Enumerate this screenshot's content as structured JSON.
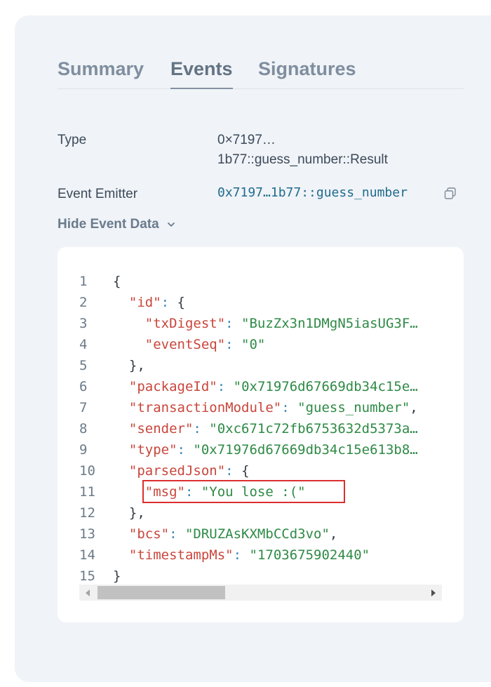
{
  "tabs": [
    {
      "label": "Summary",
      "active": false
    },
    {
      "label": "Events",
      "active": true
    },
    {
      "label": "Signatures",
      "active": false
    }
  ],
  "event": {
    "type_label": "Type",
    "type_value_line1": "0×7197…",
    "type_value_line2": "1b77::guess_number::Result",
    "emitter_label": "Event Emitter",
    "emitter_value": "0x7197…1b77::guess_number",
    "emitter_icon": "copy-icon"
  },
  "toggle": {
    "label": "Hide Event Data",
    "icon": "chevron-down-icon"
  },
  "code_lines": [
    {
      "n": "1",
      "tokens": [
        {
          "t": "{",
          "c": "x"
        }
      ]
    },
    {
      "n": "2",
      "tokens": [
        {
          "t": "  ",
          "c": "x"
        },
        {
          "t": "\"id\"",
          "c": "k"
        },
        {
          "t": ": ",
          "c": "p"
        },
        {
          "t": "{",
          "c": "x"
        }
      ]
    },
    {
      "n": "3",
      "tokens": [
        {
          "t": "    ",
          "c": "x"
        },
        {
          "t": "\"txDigest\"",
          "c": "k"
        },
        {
          "t": ": ",
          "c": "p"
        },
        {
          "t": "\"BuzZx3n1DMgN5iasUG3F…",
          "c": "s"
        }
      ]
    },
    {
      "n": "4",
      "tokens": [
        {
          "t": "    ",
          "c": "x"
        },
        {
          "t": "\"eventSeq\"",
          "c": "k"
        },
        {
          "t": ": ",
          "c": "p"
        },
        {
          "t": "\"0\"",
          "c": "s"
        }
      ]
    },
    {
      "n": "5",
      "tokens": [
        {
          "t": "  },",
          "c": "x"
        }
      ]
    },
    {
      "n": "6",
      "tokens": [
        {
          "t": "  ",
          "c": "x"
        },
        {
          "t": "\"packageId\"",
          "c": "k"
        },
        {
          "t": ": ",
          "c": "p"
        },
        {
          "t": "\"0x71976d67669db34c15e…",
          "c": "s"
        }
      ]
    },
    {
      "n": "7",
      "tokens": [
        {
          "t": "  ",
          "c": "x"
        },
        {
          "t": "\"transactionModule\"",
          "c": "k"
        },
        {
          "t": ": ",
          "c": "p"
        },
        {
          "t": "\"guess_number\"",
          "c": "s"
        },
        {
          "t": ",",
          "c": "x"
        }
      ]
    },
    {
      "n": "8",
      "tokens": [
        {
          "t": "  ",
          "c": "x"
        },
        {
          "t": "\"sender\"",
          "c": "k"
        },
        {
          "t": ": ",
          "c": "p"
        },
        {
          "t": "\"0xc671c72fb6753632d5373a…",
          "c": "s"
        }
      ]
    },
    {
      "n": "9",
      "tokens": [
        {
          "t": "  ",
          "c": "x"
        },
        {
          "t": "\"type\"",
          "c": "k"
        },
        {
          "t": ": ",
          "c": "p"
        },
        {
          "t": "\"0x71976d67669db34c15e613b8…",
          "c": "s"
        }
      ]
    },
    {
      "n": "10",
      "tokens": [
        {
          "t": "  ",
          "c": "x"
        },
        {
          "t": "\"parsedJson\"",
          "c": "k"
        },
        {
          "t": ": ",
          "c": "p"
        },
        {
          "t": "{",
          "c": "x"
        }
      ]
    },
    {
      "n": "11",
      "tokens": [
        {
          "t": "    ",
          "c": "x"
        },
        {
          "t": "\"msg\"",
          "c": "k"
        },
        {
          "t": ": ",
          "c": "p"
        },
        {
          "t": "\"You lose :(\"",
          "c": "s"
        }
      ]
    },
    {
      "n": "12",
      "tokens": [
        {
          "t": "  },",
          "c": "x"
        }
      ]
    },
    {
      "n": "13",
      "tokens": [
        {
          "t": "  ",
          "c": "x"
        },
        {
          "t": "\"bcs\"",
          "c": "k"
        },
        {
          "t": ": ",
          "c": "p"
        },
        {
          "t": "\"DRUZAsKXMbCCd3vo\"",
          "c": "s"
        },
        {
          "t": ",",
          "c": "x"
        }
      ]
    },
    {
      "n": "14",
      "tokens": [
        {
          "t": "  ",
          "c": "x"
        },
        {
          "t": "\"timestampMs\"",
          "c": "k"
        },
        {
          "t": ": ",
          "c": "p"
        },
        {
          "t": "\"1703675902440\"",
          "c": "s"
        }
      ]
    },
    {
      "n": "15",
      "tokens": [
        {
          "t": "}",
          "c": "x"
        }
      ]
    }
  ],
  "scrollbar": {
    "horizontal_position": 0.0
  }
}
